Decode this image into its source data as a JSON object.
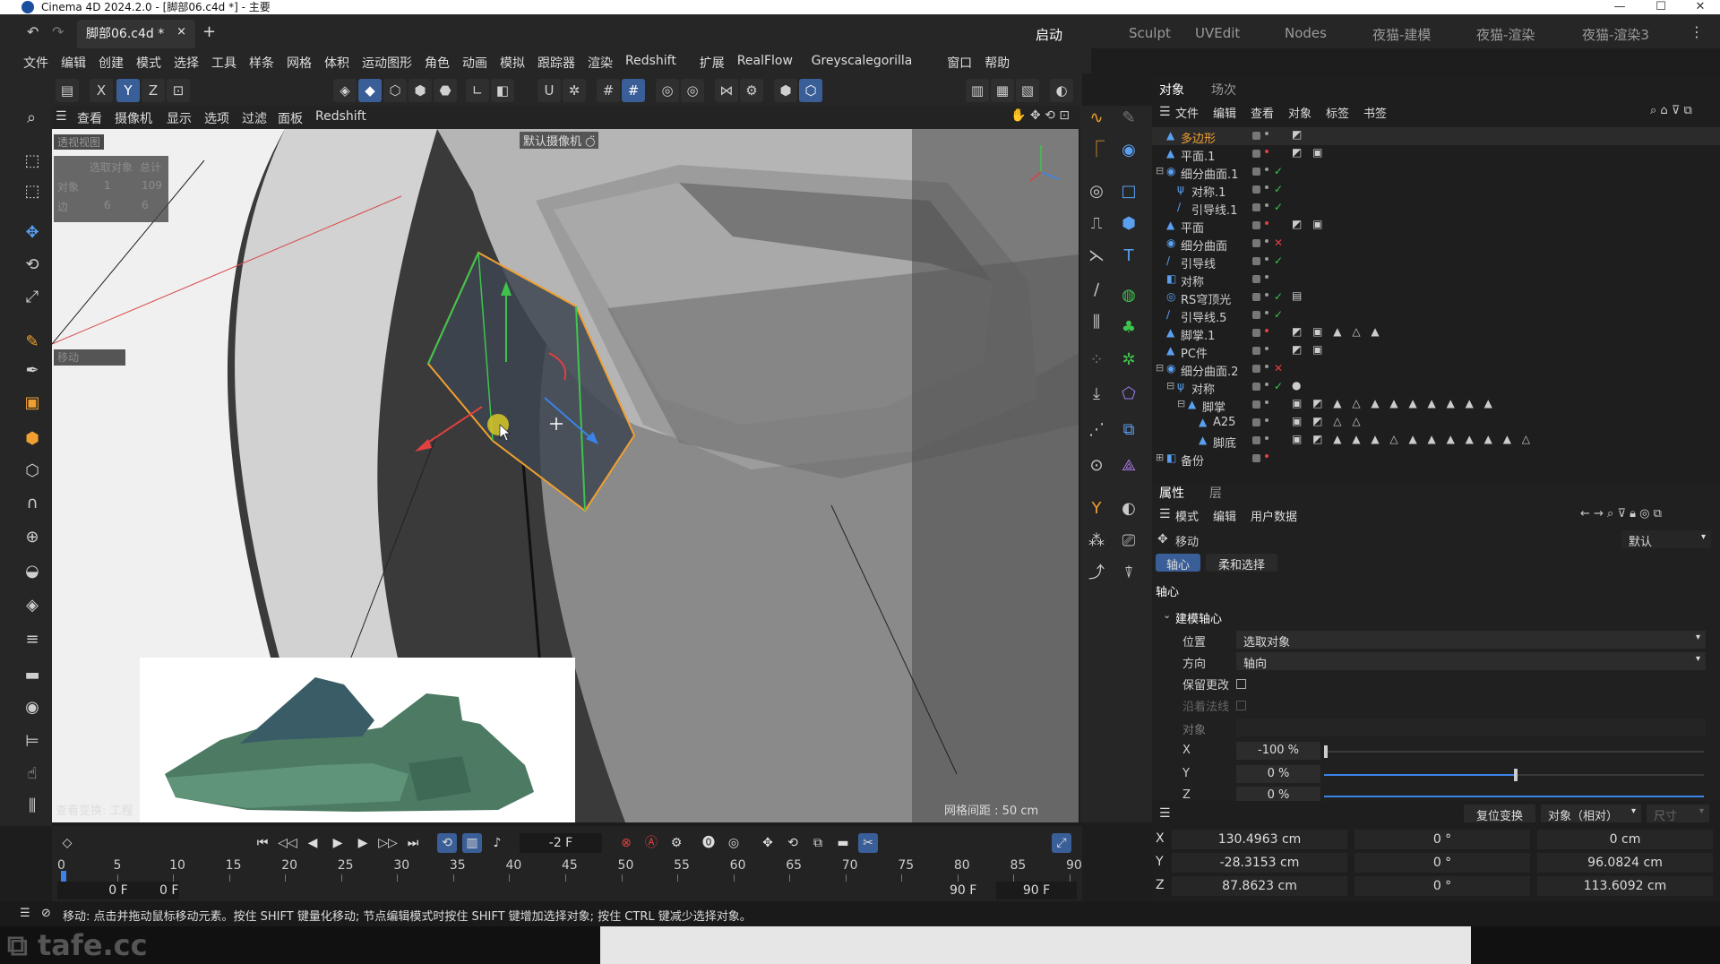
{
  "window": {
    "title": "Cinema 4D 2024.2.0 - [脚部06.c4d *] - 主要",
    "minimize": "—",
    "maximize": "☐",
    "close": "✕"
  },
  "doc_tab": {
    "label": "脚部06.c4d *",
    "close": "×",
    "add": "+"
  },
  "layouts": [
    "启动",
    "Sculpt",
    "UVEdit",
    "Nodes",
    "夜猫-建模",
    "夜猫-渲染",
    "夜猫-渲染3"
  ],
  "menu": [
    "文件",
    "编辑",
    "创建",
    "模式",
    "选择",
    "工具",
    "样条",
    "网格",
    "体积",
    "运动图形",
    "角色",
    "动画",
    "模拟",
    "跟踪器",
    "渲染",
    "Redshift",
    "扩展",
    "RealFlow",
    "Greyscalegorilla",
    "窗口",
    "帮助"
  ],
  "axis_toggles": [
    "X",
    "Y",
    "Z"
  ],
  "viewport_menu": [
    "查看",
    "摄像机",
    "显示",
    "选项",
    "过滤",
    "面板",
    "Redshift"
  ],
  "viewport": {
    "view_name": "透视视图",
    "camera_label": "默认摄像机 ○̈",
    "stats_header": [
      "选取对象",
      "总计"
    ],
    "stats_rows": [
      {
        "label": "对象",
        "sel": "1",
        "total": "109"
      },
      {
        "label": "边",
        "sel": "6",
        "total": "6"
      }
    ],
    "move_label": "移动",
    "grid_spacing": "网格间距 : 50 cm",
    "view_transform": "查看变换: 工程"
  },
  "object_panel": {
    "tabs": [
      "对象",
      "场次"
    ],
    "menu": [
      "文件",
      "编辑",
      "查看",
      "对象",
      "标签",
      "书签"
    ],
    "objects": [
      {
        "name": "多边形",
        "expander": "",
        "icon": "▲",
        "dot": "#9a9a9a",
        "status": "",
        "tags": "◩",
        "highlight": true
      },
      {
        "name": "平面.1",
        "expander": "",
        "icon": "▲",
        "dot": "#e04040",
        "status": "",
        "tags": "◩ ▣"
      },
      {
        "name": "细分曲面.1",
        "expander": "⊟",
        "icon": "◉",
        "dot": "#9a9a9a",
        "status": "✓",
        "tags": ""
      },
      {
        "name": "对称.1",
        "expander": "",
        "icon": "ψ",
        "dot": "#9a9a9a",
        "status": "✓",
        "tags": ""
      },
      {
        "name": "引导线.1",
        "expander": "",
        "icon": "∕",
        "dot": "#9a9a9a",
        "status": "✓",
        "tags": ""
      },
      {
        "name": "平面",
        "expander": "",
        "icon": "▲",
        "dot": "#e04040",
        "status": "",
        "tags": "◩ ▣"
      },
      {
        "name": "细分曲面",
        "expander": "",
        "icon": "◉",
        "dot": "#9a9a9a",
        "status": "✕",
        "tags": ""
      },
      {
        "name": "引导线",
        "expander": "",
        "icon": "∕",
        "dot": "#9a9a9a",
        "status": "✓",
        "tags": ""
      },
      {
        "name": "对称",
        "expander": "",
        "icon": "◧",
        "dot": "#9a9a9a",
        "status": "",
        "tags": ""
      },
      {
        "name": "RS穹顶光",
        "expander": "",
        "icon": "◎",
        "dot": "#9a9a9a",
        "status": "✓",
        "tags": "▤"
      },
      {
        "name": "引导线.5",
        "expander": "",
        "icon": "∕",
        "dot": "#9a9a9a",
        "status": "✓",
        "tags": ""
      },
      {
        "name": "脚掌.1",
        "expander": "",
        "icon": "▲",
        "dot": "#e04040",
        "status": "",
        "tags": "◩ ▣ ▲ △ ▲"
      },
      {
        "name": "PC件",
        "expander": "",
        "icon": "▲",
        "dot": "#9a9a9a",
        "status": "",
        "tags": "◩ ▣"
      },
      {
        "name": "细分曲面.2",
        "expander": "⊟",
        "icon": "◉",
        "dot": "#9a9a9a",
        "status": "✕",
        "tags": ""
      },
      {
        "name": "对称",
        "expander": "⊟",
        "icon": "ψ",
        "dot": "#9a9a9a",
        "status": "✓",
        "tags": "●"
      },
      {
        "name": "脚掌",
        "expander": "⊟",
        "icon": "▲",
        "dot": "#9a9a9a",
        "status": "",
        "tags": "▣ ◩ ▲ △ ▲ ▲ ▲ ▲ ▲ ▲ ▲"
      },
      {
        "name": "A25",
        "expander": "",
        "icon": "▲",
        "dot": "#9a9a9a",
        "status": "",
        "tags": "▣ ◩ △ △"
      },
      {
        "name": "脚底",
        "expander": "",
        "icon": "▲",
        "dot": "#9a9a9a",
        "status": "",
        "tags": "▣ ◩ ▲ ▲ ▲ △ ▲ ▲ ▲ ▲ ▲ ▲ △"
      },
      {
        "name": "备份",
        "expander": "⊞",
        "icon": "◧",
        "dot": "#e04040",
        "status": "",
        "tags": ""
      }
    ]
  },
  "attributes": {
    "tabs": [
      "属性",
      "层"
    ],
    "menu": [
      "模式",
      "编辑",
      "用户数据"
    ],
    "tool_name": "移动",
    "preset": "默认",
    "subtabs": [
      "轴心",
      "柔和选择"
    ],
    "section": "轴心",
    "group": "建模轴心",
    "fields": [
      {
        "label": "位置",
        "value": "选取对象"
      },
      {
        "label": "方向",
        "value": "轴向"
      }
    ],
    "keep_changes": "保留更改",
    "along_normal": "沿着法线",
    "object_label": "对象",
    "x_label": "X",
    "x_value": "-100 %",
    "x_fraction": -1,
    "y_label": "Y",
    "y_value": "0 %",
    "y_fraction": 0,
    "z_label": "Z",
    "z_value": "0 %"
  },
  "coords": {
    "reset": "复位变换",
    "mode": "对象（相对）",
    "size_label": "尺寸",
    "rows": [
      {
        "axis": "X",
        "pos": "130.4963 cm",
        "rot": "0 °",
        "size": "0 cm"
      },
      {
        "axis": "Y",
        "pos": "-28.3153 cm",
        "rot": "0 °",
        "size": "96.0824 cm"
      },
      {
        "axis": "Z",
        "pos": "87.8623 cm",
        "rot": "0 °",
        "size": "113.6092 cm"
      }
    ]
  },
  "timeline": {
    "current_frame": "-2 F",
    "ticks": [
      "0",
      "5",
      "10",
      "15",
      "20",
      "25",
      "30",
      "35",
      "40",
      "45",
      "50",
      "55",
      "60",
      "65",
      "70",
      "75",
      "80",
      "85",
      "90"
    ],
    "start": "0 F",
    "start2": "0 F",
    "end": "90 F",
    "end2": "90 F"
  },
  "status": "移动: 点击并拖动鼠标移动元素。按住 SHIFT 键量化移动; 节点编辑模式时按住 SHIFT 键增加选择对象; 按住 CTRL 键减少选择对象。",
  "watermark": "tafe.cc",
  "colors": {
    "accent": "#3b83e8",
    "selection": "#f0a030",
    "check": "#3ec44d",
    "cross": "#e04040"
  }
}
